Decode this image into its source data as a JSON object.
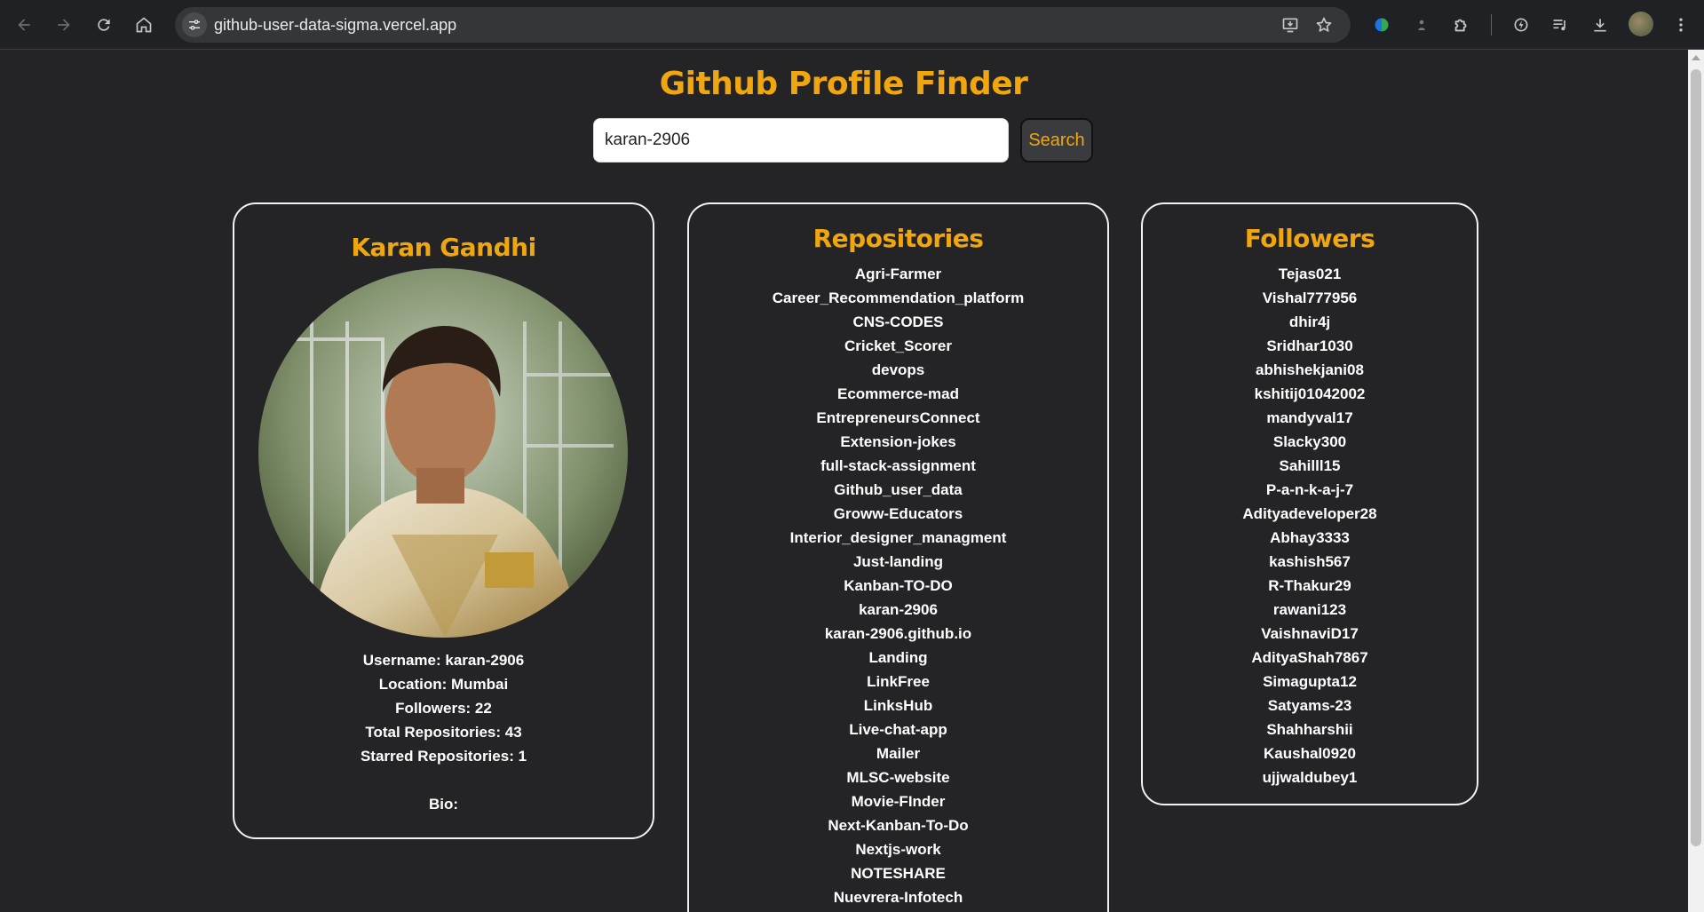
{
  "browser": {
    "url": "github-user-data-sigma.vercel.app"
  },
  "page": {
    "title": "Github Profile Finder",
    "search": {
      "value": "karan-2906",
      "button_label": "Search"
    }
  },
  "profile": {
    "name": "Karan Gandhi",
    "username_line": "Username: karan-2906",
    "location_line": "Location: Mumbai",
    "followers_line": "Followers: 22",
    "repos_line": "Total Repositories: 43",
    "starred_line": "Starred Repositories: 1",
    "bio_line": "Bio:"
  },
  "repositories": {
    "heading": "Repositories",
    "items": [
      "Agri-Farmer",
      "Career_Recommendation_platform",
      "CNS-CODES",
      "Cricket_Scorer",
      "devops",
      "Ecommerce-mad",
      "EntrepreneursConnect",
      "Extension-jokes",
      "full-stack-assignment",
      "Github_user_data",
      "Groww-Educators",
      "Interior_designer_managment",
      "Just-landing",
      "Kanban-TO-DO",
      "karan-2906",
      "karan-2906.github.io",
      "Landing",
      "LinkFree",
      "LinksHub",
      "Live-chat-app",
      "Mailer",
      "MLSC-website",
      "Movie-FInder",
      "Next-Kanban-To-Do",
      "Nextjs-work",
      "NOTESHARE",
      "Nuevrera-Infotech"
    ]
  },
  "followers": {
    "heading": "Followers",
    "items": [
      "Tejas021",
      "Vishal777956",
      "dhir4j",
      "Sridhar1030",
      "abhishekjani08",
      "kshitij01042002",
      "mandyval17",
      "Slacky300",
      "Sahilll15",
      "P-a-n-k-a-j-7",
      "Adityadeveloper28",
      "Abhay3333",
      "kashish567",
      "R-Thakur29",
      "rawani123",
      "VaishnaviD17",
      "AdityaShah7867",
      "Simagupta12",
      "Satyams-23",
      "Shahharshii",
      "Kaushal0920",
      "ujjwaldubey1"
    ]
  },
  "icons": {
    "back": "arrow-left-icon",
    "forward": "arrow-right-icon",
    "reload": "reload-icon",
    "home": "home-icon",
    "site_info": "tune-icon",
    "install": "install-app-icon",
    "bookmark": "star-icon",
    "extensions": [
      "color-extension-icon",
      "user-extension-icon",
      "puzzle-icon",
      "performance-icon",
      "media-icon",
      "download-icon"
    ],
    "menu": "more-vert-icon"
  },
  "colors": {
    "accent": "#f0a60f",
    "background": "#242426"
  }
}
